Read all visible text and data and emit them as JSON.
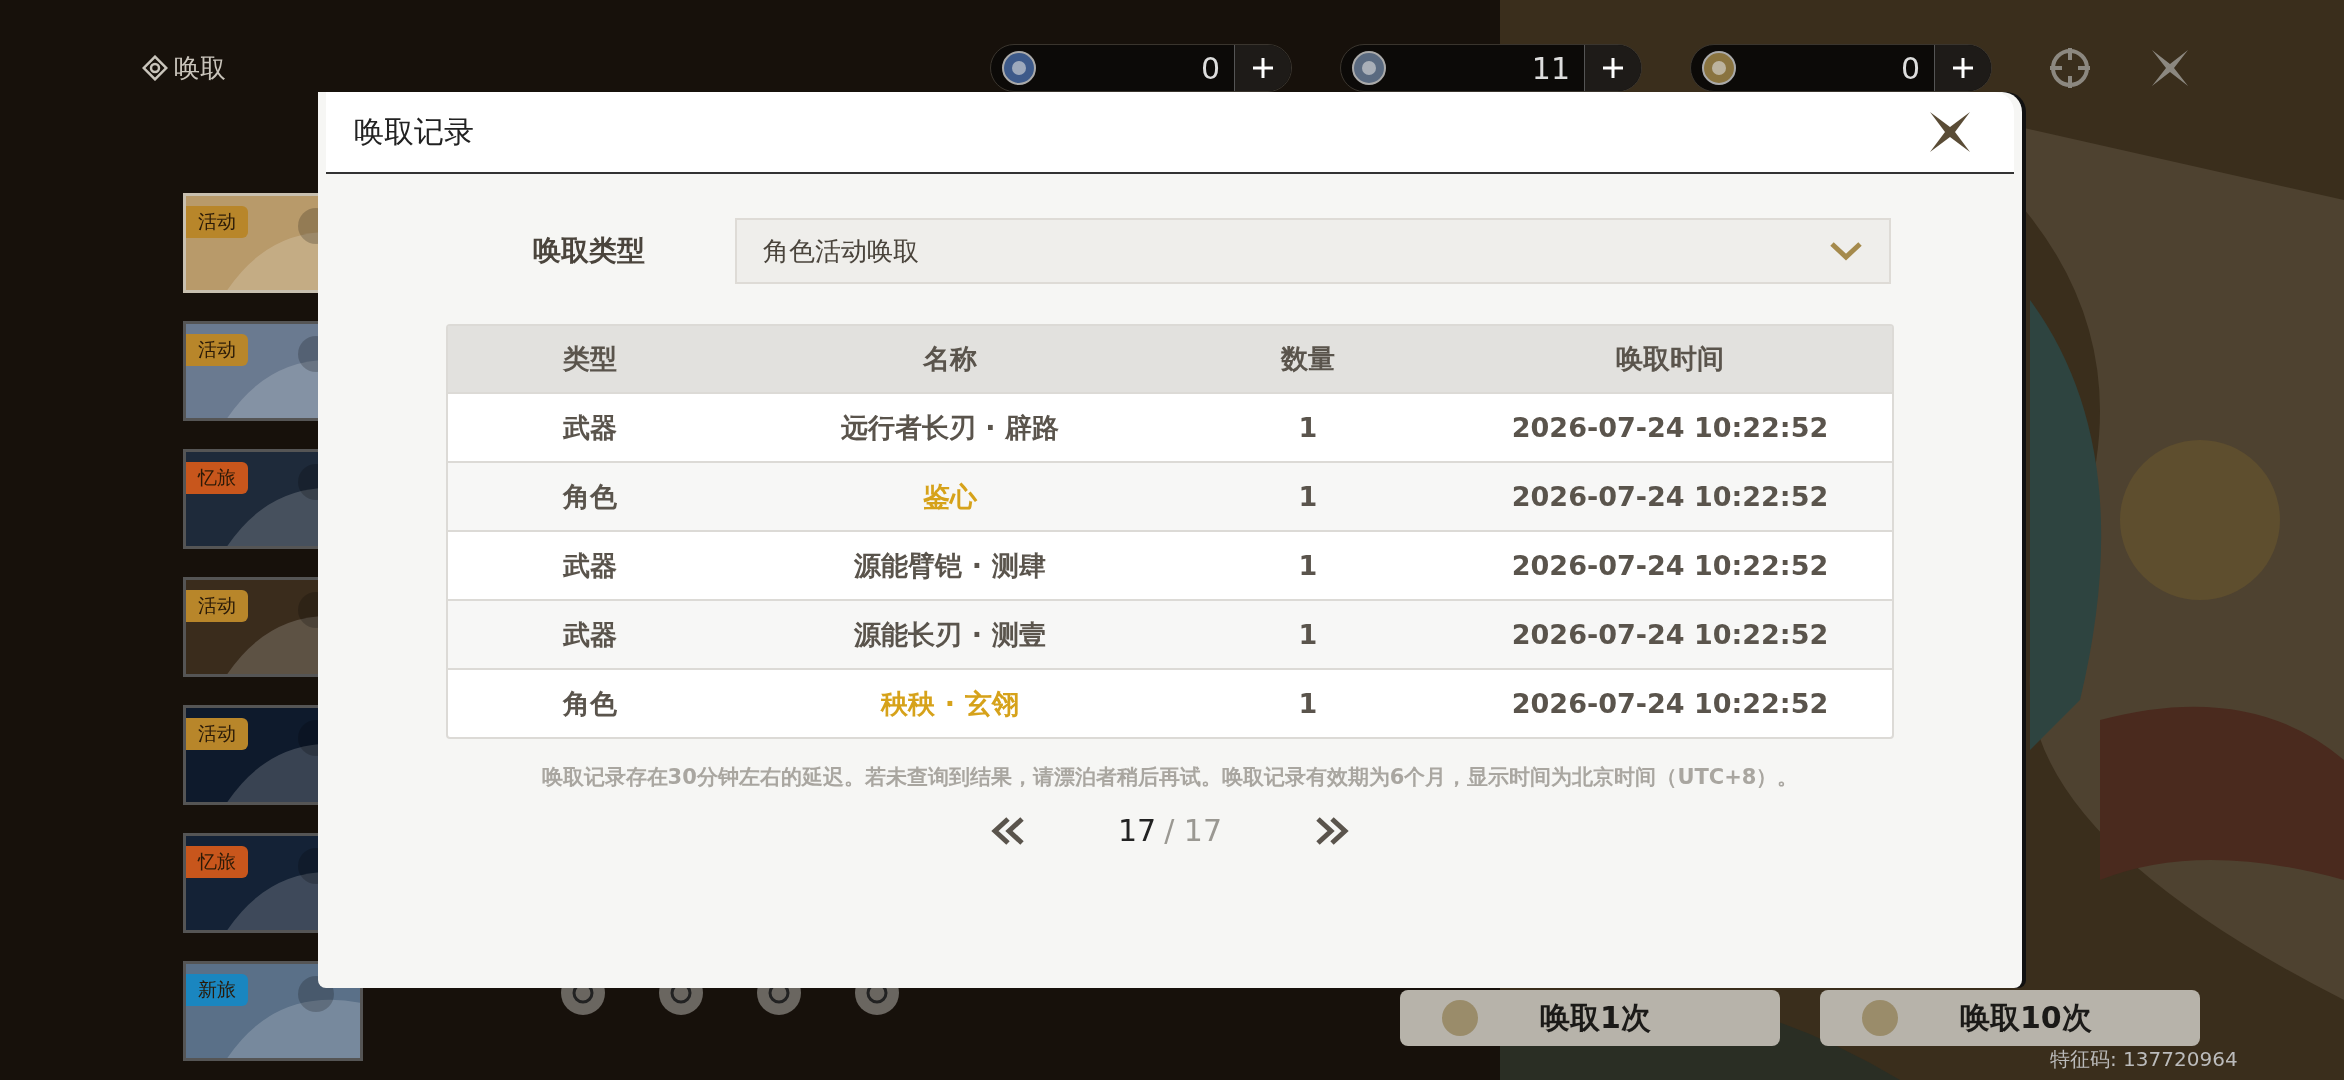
{
  "header": {
    "title": "唤取"
  },
  "currencies": [
    {
      "amount": "0"
    },
    {
      "amount": "11"
    },
    {
      "amount": "0"
    }
  ],
  "banners": [
    {
      "tag": "活动",
      "color": "#b8862a",
      "selected": true
    },
    {
      "tag": "活动",
      "color": "#b8862a",
      "selected": false
    },
    {
      "tag": "忆旅",
      "color": "#c8561c",
      "selected": false
    },
    {
      "tag": "活动",
      "color": "#b8862a",
      "selected": false
    },
    {
      "tag": "活动",
      "color": "#b8862a",
      "selected": false
    },
    {
      "tag": "忆旅",
      "color": "#c8561c",
      "selected": false
    },
    {
      "tag": "新旅",
      "color": "#1a86c0",
      "selected": false
    }
  ],
  "pull_buttons": [
    {
      "label": "唤取1次"
    },
    {
      "label": "唤取10次"
    }
  ],
  "footer": {
    "code": "特征码: 137720964"
  },
  "dialog": {
    "title": "唤取记录",
    "filter": {
      "label": "唤取类型",
      "value": "角色活动唤取"
    },
    "table": {
      "columns": [
        "类型",
        "名称",
        "数量",
        "唤取时间"
      ],
      "rows": [
        {
          "cells": [
            "武器",
            "远行者长刃 · 辟路",
            "1",
            "2026-07-24 10:22:52"
          ],
          "highlight": false
        },
        {
          "cells": [
            "角色",
            "鉴心",
            "1",
            "2026-07-24 10:22:52"
          ],
          "highlight": true
        },
        {
          "cells": [
            "武器",
            "源能臂铠 · 测肆",
            "1",
            "2026-07-24 10:22:52"
          ],
          "highlight": false
        },
        {
          "cells": [
            "武器",
            "源能长刃 · 测壹",
            "1",
            "2026-07-24 10:22:52"
          ],
          "highlight": false
        },
        {
          "cells": [
            "角色",
            "秧秧 · 玄翎",
            "1",
            "2026-07-24 10:22:52"
          ],
          "highlight": true
        }
      ]
    },
    "note": "唤取记录存在30分钟左右的延迟。若未查询到结果，请漂泊者稍后再试。唤取记录有效期为6个月，显示时间为北京时间（UTC+8）。",
    "pagination": {
      "current": "17",
      "total": "/ 17"
    }
  }
}
